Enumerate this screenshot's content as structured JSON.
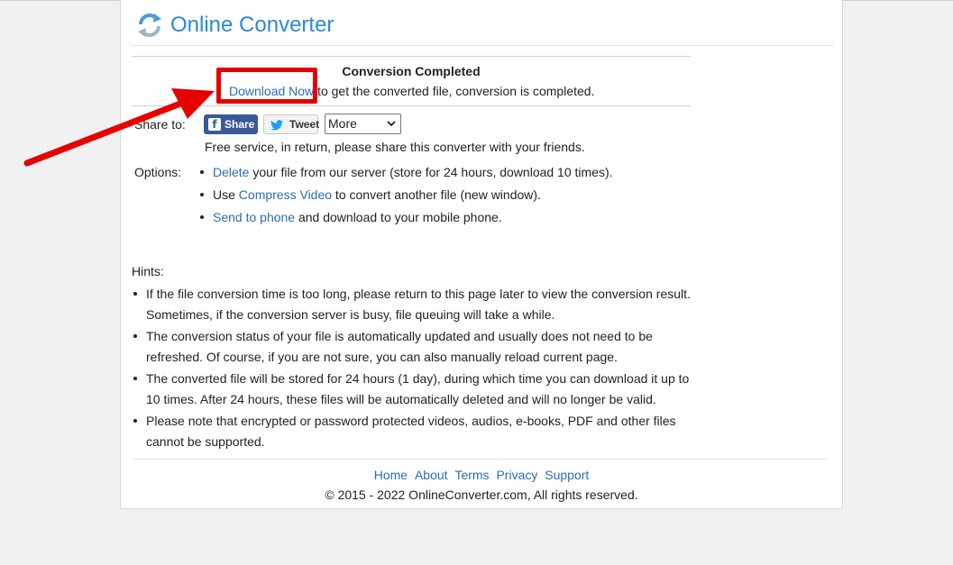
{
  "brand": {
    "name": "Online Converter"
  },
  "result": {
    "title": "Conversion Completed",
    "download_link": "Download Now",
    "download_suffix": " to get the converted file, conversion is completed."
  },
  "share": {
    "label": "Share to:",
    "facebook_label": "Share",
    "twitter_label": "Tweet",
    "more_selected": "More",
    "note": "Free service, in return, please share this converter with your friends."
  },
  "options": {
    "label": "Options:",
    "items": [
      {
        "link": "Delete",
        "prefix": "",
        "suffix": " your file from our server (store for 24 hours, download 10 times)."
      },
      {
        "prefix": "Use ",
        "link": "Compress Video",
        "suffix": " to convert another file (new window)."
      },
      {
        "prefix": "",
        "link": "Send to phone",
        "suffix": " and download to your mobile phone."
      }
    ]
  },
  "hints": {
    "label": "Hints:",
    "items": [
      "If the file conversion time is too long, please return to this page later to view the conversion result. Sometimes, if the conversion server is busy, file queuing will take a while.",
      "The conversion status of your file is automatically updated and usually does not need to be refreshed. Of course, if you are not sure, you can also manually reload current page.",
      "The converted file will be stored for 24 hours (1 day), during which time you can download it up to 10 times. After 24 hours, these files will be automatically deleted and will no longer be valid.",
      "Please note that encrypted or password protected videos, audios, e-books, PDF and other files cannot be supported."
    ]
  },
  "footer": {
    "links": [
      "Home",
      "About",
      "Terms",
      "Privacy",
      "Support"
    ],
    "copyright": "© 2015 - 2022 OnlineConverter.com, All rights reserved."
  },
  "colors": {
    "link": "#2a6db5",
    "brand": "#2a8ad4",
    "highlight": "#e60000",
    "facebook": "#3b5998"
  }
}
